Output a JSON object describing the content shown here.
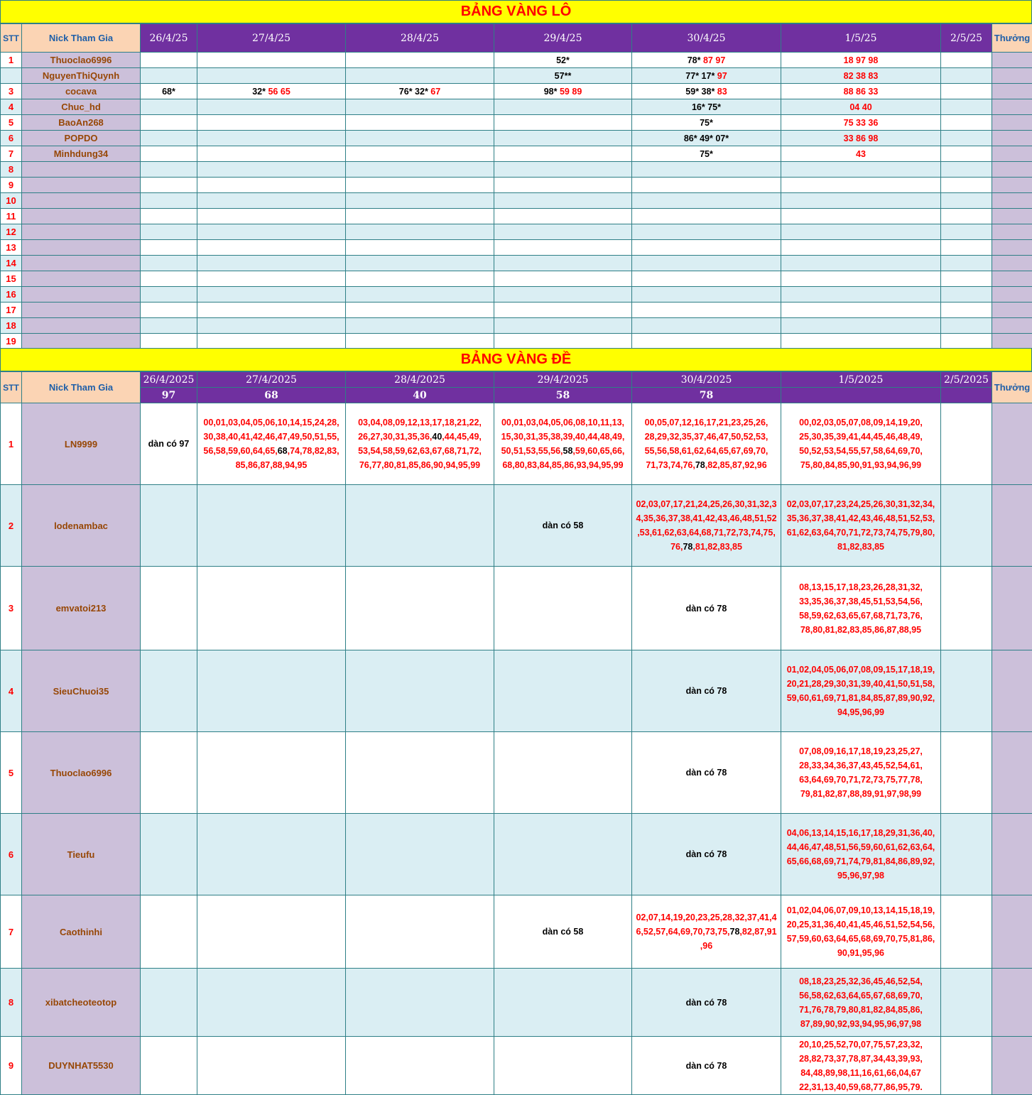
{
  "lo": {
    "title": "BẢNG VÀNG LÔ",
    "headers": {
      "stt": "STT",
      "nick": "Nick Tham Gia",
      "thuong": "Thưởng",
      "dates": [
        "26/4/25",
        "27/4/25",
        "28/4/25",
        "29/4/25",
        "30/4/25",
        "1/5/25",
        "2/5/25"
      ]
    },
    "rows": [
      {
        "stt": "1",
        "nick": "Thuoclao6996",
        "cells": [
          [],
          [],
          [],
          [
            [
              "52*",
              "k"
            ]
          ],
          [
            [
              "78* ",
              "k"
            ],
            [
              "87 97",
              "r"
            ]
          ],
          [
            [
              "18 97 98",
              "r"
            ]
          ],
          []
        ]
      },
      {
        "stt": "",
        "nick": "NguyenThiQuynh",
        "cells": [
          [],
          [],
          [],
          [
            [
              "57**",
              "k"
            ]
          ],
          [
            [
              "77* 17* ",
              "k"
            ],
            [
              "97",
              "r"
            ]
          ],
          [
            [
              "82 38 83",
              "r"
            ]
          ],
          []
        ]
      },
      {
        "stt": "3",
        "nick": "cocava",
        "cells": [
          [
            [
              "68*",
              "k"
            ]
          ],
          [
            [
              "32* ",
              "k"
            ],
            [
              "56 65",
              "r"
            ]
          ],
          [
            [
              "76* 32* ",
              "k"
            ],
            [
              "67",
              "r"
            ]
          ],
          [
            [
              "98* ",
              "k"
            ],
            [
              "59 89",
              "r"
            ]
          ],
          [
            [
              "59* 38* ",
              "k"
            ],
            [
              "83",
              "r"
            ]
          ],
          [
            [
              "88 86 33",
              "r"
            ]
          ],
          []
        ]
      },
      {
        "stt": "4",
        "nick": "Chuc_hd",
        "cells": [
          [],
          [],
          [],
          [],
          [
            [
              "16* 75*",
              "k"
            ]
          ],
          [
            [
              "04 40",
              "r"
            ]
          ],
          []
        ]
      },
      {
        "stt": "5",
        "nick": "BaoAn268",
        "cells": [
          [],
          [],
          [],
          [],
          [
            [
              "75*",
              "k"
            ]
          ],
          [
            [
              "75 33 36",
              "r"
            ]
          ],
          []
        ]
      },
      {
        "stt": "6",
        "nick": "POPDO",
        "cells": [
          [],
          [],
          [],
          [],
          [
            [
              "86* 49* 07*",
              "k"
            ]
          ],
          [
            [
              "33 86 98",
              "r"
            ]
          ],
          []
        ]
      },
      {
        "stt": "7",
        "nick": "Minhdung34",
        "cells": [
          [],
          [],
          [],
          [],
          [
            [
              "75*",
              "k"
            ]
          ],
          [
            [
              "43",
              "r"
            ]
          ],
          []
        ]
      },
      {
        "stt": "8",
        "nick": "",
        "cells": [
          [],
          [],
          [],
          [],
          [],
          [],
          []
        ]
      },
      {
        "stt": "9",
        "nick": "",
        "cells": [
          [],
          [],
          [],
          [],
          [],
          [],
          []
        ]
      },
      {
        "stt": "10",
        "nick": "",
        "cells": [
          [],
          [],
          [],
          [],
          [],
          [],
          []
        ]
      },
      {
        "stt": "11",
        "nick": "",
        "cells": [
          [],
          [],
          [],
          [],
          [],
          [],
          []
        ]
      },
      {
        "stt": "12",
        "nick": "",
        "cells": [
          [],
          [],
          [],
          [],
          [],
          [],
          []
        ]
      },
      {
        "stt": "13",
        "nick": "",
        "cells": [
          [],
          [],
          [],
          [],
          [],
          [],
          []
        ]
      },
      {
        "stt": "14",
        "nick": "",
        "cells": [
          [],
          [],
          [],
          [],
          [],
          [],
          []
        ]
      },
      {
        "stt": "15",
        "nick": "",
        "cells": [
          [],
          [],
          [],
          [],
          [],
          [],
          []
        ]
      },
      {
        "stt": "16",
        "nick": "",
        "cells": [
          [],
          [],
          [],
          [],
          [],
          [],
          []
        ]
      },
      {
        "stt": "17",
        "nick": "",
        "cells": [
          [],
          [],
          [],
          [],
          [],
          [],
          []
        ]
      },
      {
        "stt": "18",
        "nick": "",
        "cells": [
          [],
          [],
          [],
          [],
          [],
          [],
          []
        ]
      },
      {
        "stt": "19",
        "nick": "",
        "cells": [
          [],
          [],
          [],
          [],
          [],
          [],
          []
        ]
      }
    ]
  },
  "de": {
    "title": "BẢNG VÀNG ĐỀ",
    "headers": {
      "stt": "STT",
      "nick": "Nick Tham Gia",
      "thuong": "Thưởng",
      "dates": [
        "26/4/2025",
        "27/4/2025",
        "28/4/2025",
        "29/4/2025",
        "30/4/2025",
        "1/5/2025",
        "2/5/2025"
      ],
      "results": [
        "97",
        "68",
        "40",
        "58",
        "78",
        "",
        ""
      ]
    },
    "rows": [
      {
        "stt": "1",
        "nick": "LN9999",
        "cells": [
          {
            "dan": "dàn có 97"
          },
          {
            "lines": [
              "00,01,03,04,05,06,10,14,15,24,28,",
              "30,38,40,41,42,46,47,49,50,51,55,",
              "56,58,59,60,64,65,[68],74,78,82,83,",
              "85,86,87,88,94,95"
            ]
          },
          {
            "lines": [
              "03,04,08,09,12,13,17,18,21,22,",
              "26,27,30,31,35,36,[40],44,45,49,",
              "53,54,58,59,62,63,67,68,71,72,",
              "76,77,80,81,85,86,90,94,95,99"
            ]
          },
          {
            "lines": [
              "00,01,03,04,05,06,08,10,11,13,",
              "15,30,31,35,38,39,40,44,48,49,",
              "50,51,53,55,56,[58],59,60,65,66,",
              "68,80,83,84,85,86,93,94,95,99"
            ]
          },
          {
            "lines": [
              "00,05,07,12,16,17,21,23,25,26,",
              "28,29,32,35,37,46,47,50,52,53,",
              "55,56,58,61,62,64,65,67,69,70,",
              "71,73,74,76,[78],82,85,87,92,96"
            ]
          },
          {
            "lines": [
              "00,02,03,05,07,08,09,14,19,20,",
              "25,30,35,39,41,44,45,46,48,49,",
              "50,52,53,54,55,57,58,64,69,70,",
              "75,80,84,85,90,91,93,94,96,99"
            ]
          },
          {}
        ]
      },
      {
        "stt": "2",
        "nick": "lodenambac",
        "cells": [
          {},
          {},
          {},
          {
            "dan": "dàn có 58"
          },
          {
            "lines": [
              "02,03,07,17,21,24,25,26,30,31,32,3",
              "4,35,36,37,38,41,42,43,46,48,51,52",
              ",53,61,62,63,64,68,71,72,73,74,75,",
              "76,[78],81,82,83,85"
            ]
          },
          {
            "lines": [
              "02,03,07,17,23,24,25,26,30,31,32,34,",
              "35,36,37,38,41,42,43,46,48,51,52,53,",
              "61,62,63,64,70,71,72,73,74,75,79,80,",
              "81,82,83,85"
            ]
          },
          {}
        ]
      },
      {
        "stt": "3",
        "nick": "emvatoi213",
        "cells": [
          {},
          {},
          {},
          {},
          {
            "dan": "dàn có 78"
          },
          {
            "lines": [
              "08,13,15,17,18,23,26,28,31,32,",
              "33,35,36,37,38,45,51,53,54,56,",
              "58,59,62,63,65,67,68,71,73,76,",
              "78,80,81,82,83,85,86,87,88,95"
            ]
          },
          {}
        ]
      },
      {
        "stt": "4",
        "nick": "SieuChuoi35",
        "cells": [
          {},
          {},
          {},
          {},
          {
            "dan": "dàn có 78"
          },
          {
            "lines": [
              "01,02,04,05,06,07,08,09,15,17,18,19,",
              "20,21,28,29,30,31,39,40,41,50,51,58,",
              "59,60,61,69,71,81,84,85,87,89,90,92,",
              "94,95,96,99"
            ]
          },
          {}
        ]
      },
      {
        "stt": "5",
        "nick": "Thuoclao6996",
        "cells": [
          {},
          {},
          {},
          {},
          {
            "dan": "dàn có 78"
          },
          {
            "lines": [
              "07,08,09,16,17,18,19,23,25,27,",
              "28,33,34,36,37,43,45,52,54,61,",
              "63,64,69,70,71,72,73,75,77,78,",
              "79,81,82,87,88,89,91,97,98,99"
            ]
          },
          {}
        ]
      },
      {
        "stt": "6",
        "nick": "Tieufu",
        "cells": [
          {},
          {},
          {},
          {},
          {
            "dan": "dàn có 78"
          },
          {
            "lines": [
              "04,06,13,14,15,16,17,18,29,31,36,40,",
              "44,46,47,48,51,56,59,60,61,62,63,64,",
              "65,66,68,69,71,74,79,81,84,86,89,92,",
              "95,96,97,98"
            ]
          },
          {}
        ]
      },
      {
        "stt": "7",
        "nick": "Caothinhi",
        "cells": [
          {},
          {},
          {},
          {
            "dan": "dàn có 58"
          },
          {
            "lines": [
              "02,07,14,19,20,23,25,28,32,37,41,4",
              "6,52,57,64,69,70,73,75,[78],82,87,91",
              ",96"
            ]
          },
          {
            "lines": [
              "01,02,04,06,07,09,10,13,14,15,18,19,",
              "20,25,31,36,40,41,45,46,51,52,54,56,",
              "57,59,60,63,64,65,68,69,70,75,81,86,",
              "90,91,95,96"
            ]
          },
          {}
        ]
      },
      {
        "stt": "8",
        "nick": "xibatcheoteotop",
        "cells": [
          {},
          {},
          {},
          {},
          {
            "dan": "dàn có 78"
          },
          {
            "lines": [
              "08,18,23,25,32,36,45,46,52,54,",
              "56,58,62,63,64,65,67,68,69,70,",
              "71,76,78,79,80,81,82,84,85,86,",
              "87,89,90,92,93,94,95,96,97,98"
            ]
          },
          {}
        ]
      },
      {
        "stt": "9",
        "nick": "DUYNHAT5530",
        "cells": [
          {},
          {},
          {},
          {},
          {
            "dan": "dàn có 78"
          },
          {
            "lines": [
              "20,10,25,52,70,07,75,57,23,32,",
              "28,82,73,37,78,87,34,43,39,93,",
              "84,48,89,98,11,16,61,66,04,67",
              "22,31,13,40,59,68,77,86,95,79."
            ]
          },
          {}
        ]
      }
    ]
  }
}
